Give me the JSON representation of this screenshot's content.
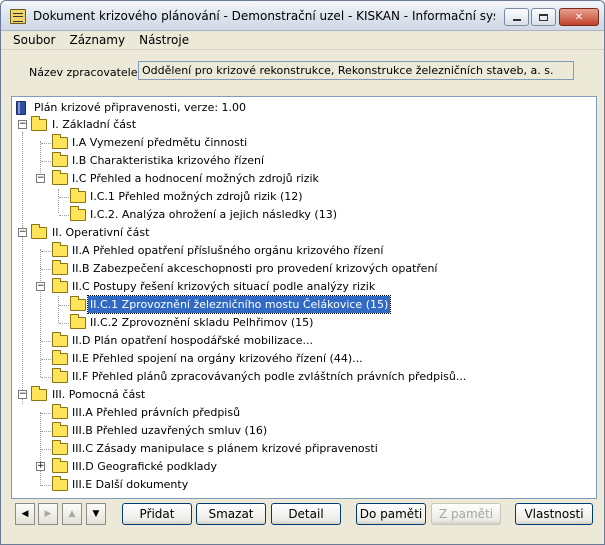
{
  "window": {
    "title": "Dokument krizového plánování - Demonstrační uzel - KISKAN - Informační systém pro..."
  },
  "menu": [
    "Soubor",
    "Záznamy",
    "Nástroje"
  ],
  "processor": {
    "label": "Název zpracovatele:",
    "value": "Oddělení pro krizové rekonstrukce, Rekonstrukce železničních staveb, a. s."
  },
  "tree": {
    "root": "Plán krizové připravenosti, verze: 1.00",
    "nodes": [
      {
        "label": "I. Základní část"
      },
      {
        "label": "I.A Vymezení předmětu činnosti"
      },
      {
        "label": "I.B Charakteristika krizového řízení"
      },
      {
        "label": "I.C Přehled a hodnocení možných zdrojů rizik"
      },
      {
        "label": "I.C.1 Přehled možných zdrojů rizik (12)"
      },
      {
        "label": "I.C.2. Analýza ohrožení a jejich následky (13)"
      },
      {
        "label": "II. Operativní část"
      },
      {
        "label": "II.A Přehled opatření příslušného orgánu krizového řízení"
      },
      {
        "label": "II.B Zabezpečení akceschopnosti pro provedení krizových opatření"
      },
      {
        "label": "II.C Postupy řešení krizových situací podle analýzy rizik"
      },
      {
        "label": "II.C.1 Zprovoznění železničního mostu Čelákovice (15)"
      },
      {
        "label": "II.C.2 Zprovoznění skladu Pelhřimov (15)"
      },
      {
        "label": "II.D Plán opatření hospodářské mobilizace..."
      },
      {
        "label": "II.E Přehled spojení na orgány krizového řízení (44)..."
      },
      {
        "label": "II.F Přehled plánů zpracovávaných podle zvláštních právních předpisů..."
      },
      {
        "label": "III. Pomocná část"
      },
      {
        "label": "III.A Přehled právních předpisů"
      },
      {
        "label": "III.B Přehled uzavřených smluv (16)"
      },
      {
        "label": "III.C Zásady manipulace s plánem krizové připravenosti"
      },
      {
        "label": "III.D Geografické podklady"
      },
      {
        "label": "III.E Další dokumenty"
      }
    ],
    "selected": "II.C.1 Zprovoznění železničního mostu Čelákovice (15)"
  },
  "buttons": {
    "add": "Přidat",
    "delete": "Smazat",
    "detail": "Detail",
    "to_memory": "Do paměti",
    "from_memory": "Z paměti",
    "properties": "Vlastnosti"
  },
  "icons": {
    "expand": "+",
    "collapse": "−"
  }
}
